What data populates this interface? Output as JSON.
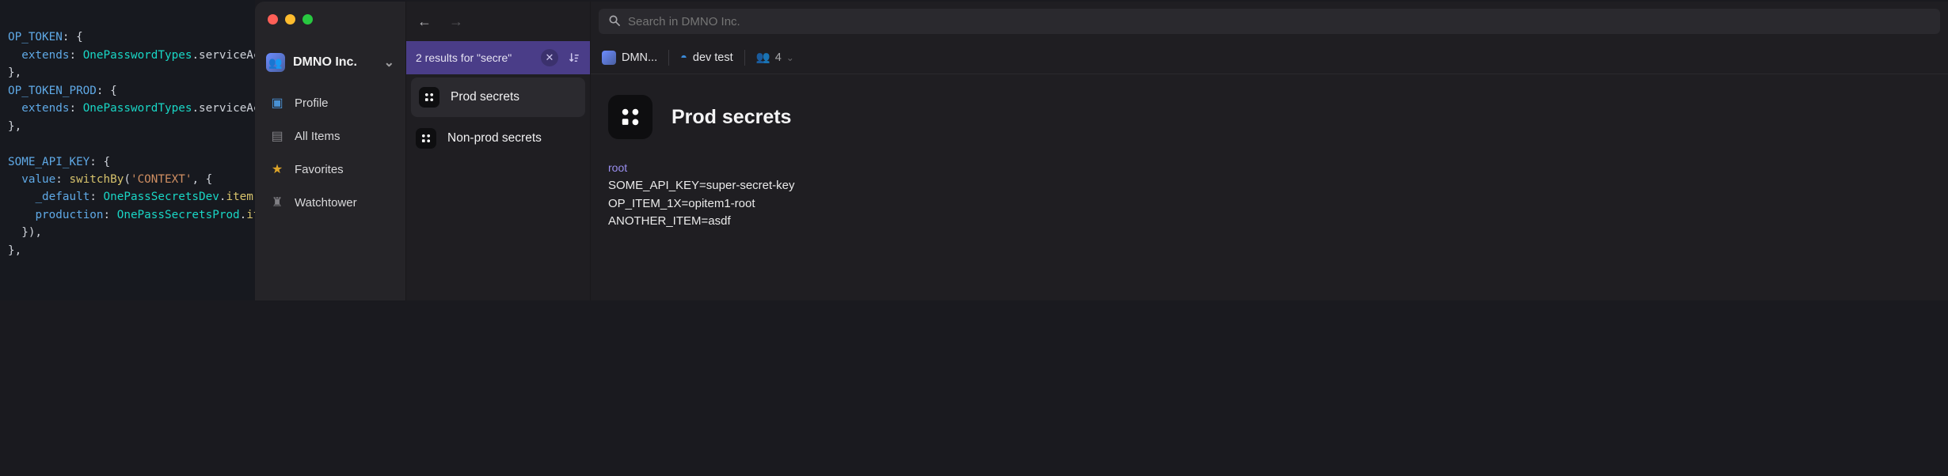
{
  "code": {
    "key1": "OP_TOKEN",
    "key2": "OP_TOKEN_PROD",
    "key3": "SOME_API_KEY",
    "extends": "extends",
    "typeName": "OnePasswordTypes",
    "svcAcct": "serviceAccountToken",
    "valueLabel": "value",
    "switchBy": "switchBy",
    "contextStr": "'CONTEXT'",
    "defaultKey": "_default",
    "devSecrets": "OnePassSecretsDev",
    "prodKey": "production",
    "prodSecrets": "OnePassSecretsProd",
    "itemCall": "item"
  },
  "sidebar": {
    "org_name": "DMNO Inc.",
    "items": [
      {
        "label": "Profile",
        "icon": "👤"
      },
      {
        "label": "All Items",
        "icon": "🗄"
      },
      {
        "label": "Favorites",
        "icon": "★"
      },
      {
        "label": "Watchtower",
        "icon": "♜"
      }
    ]
  },
  "search": {
    "placeholder": "Search in DMNO Inc.",
    "results_text": "2 results for \"secre\""
  },
  "list": {
    "items": [
      {
        "name": "Prod secrets",
        "selected": true
      },
      {
        "name": "Non-prod secrets",
        "selected": false
      }
    ]
  },
  "crumbs": {
    "org_short": "DMN...",
    "vault": "dev test",
    "members": "4"
  },
  "detail": {
    "title": "Prod secrets",
    "section": "root",
    "lines": [
      "SOME_API_KEY=super-secret-key",
      "OP_ITEM_1X=opitem1-root",
      "ANOTHER_ITEM=asdf"
    ]
  }
}
